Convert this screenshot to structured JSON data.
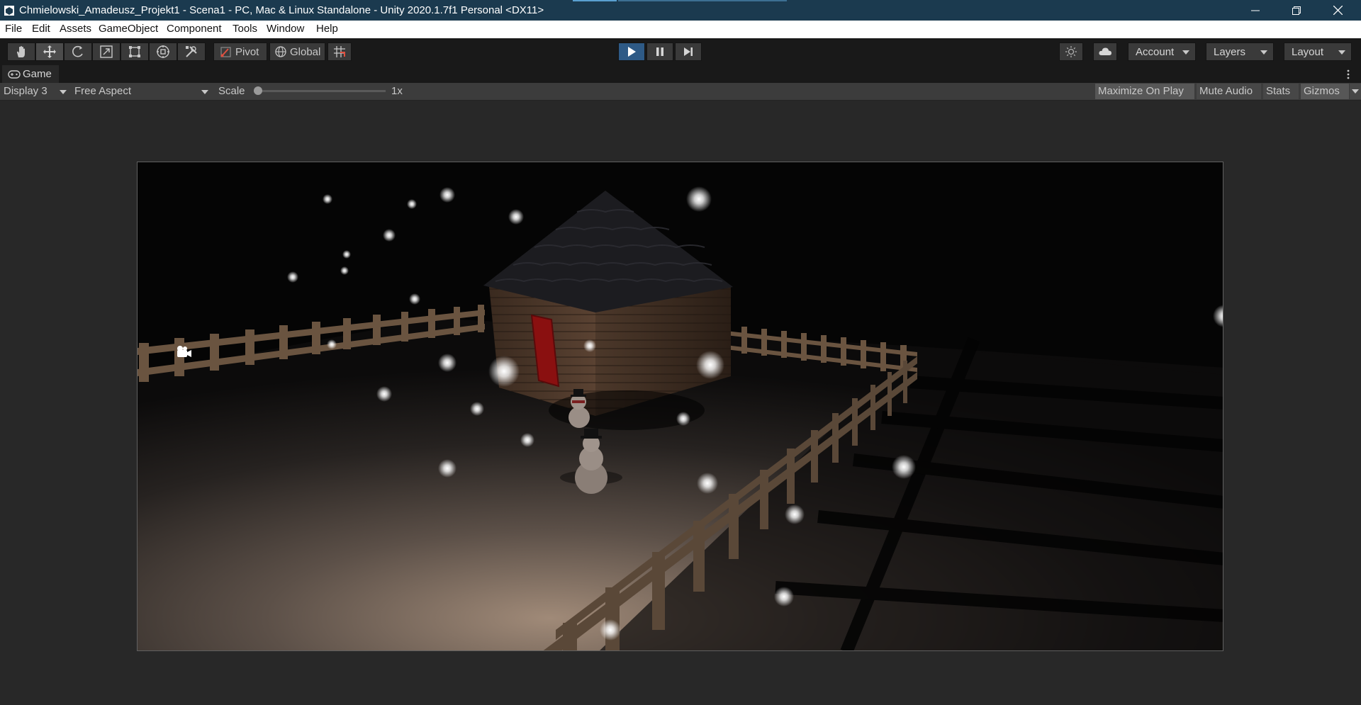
{
  "window": {
    "title": "Chmielowski_Amadeusz_Projekt1 - Scena1 - PC, Mac & Linux Standalone - Unity 2020.1.7f1 Personal <DX11>"
  },
  "menu": {
    "items": [
      "File",
      "Edit",
      "Assets",
      "GameObject",
      "Component",
      "Tools",
      "Window",
      "Help"
    ]
  },
  "toolbar": {
    "pivot_label": "Pivot",
    "global_label": "Global",
    "account_label": "Account",
    "layers_label": "Layers",
    "layout_label": "Layout"
  },
  "game_tab": {
    "label": "Game"
  },
  "game_toolbar": {
    "display": "Display 3",
    "aspect": "Free Aspect",
    "scale_label": "Scale",
    "scale_value": "1x",
    "scale_level": 0.0,
    "maximize_on_play": "Maximize On Play",
    "mute_audio": "Mute Audio",
    "stats": "Stats",
    "gizmos": "Gizmos"
  },
  "colors": {
    "titlebar": "#1b3a4f",
    "accent_play": "#2e5a86",
    "editor_bg": "#282828",
    "door": "#8a1010",
    "fence": "#6a5440"
  }
}
